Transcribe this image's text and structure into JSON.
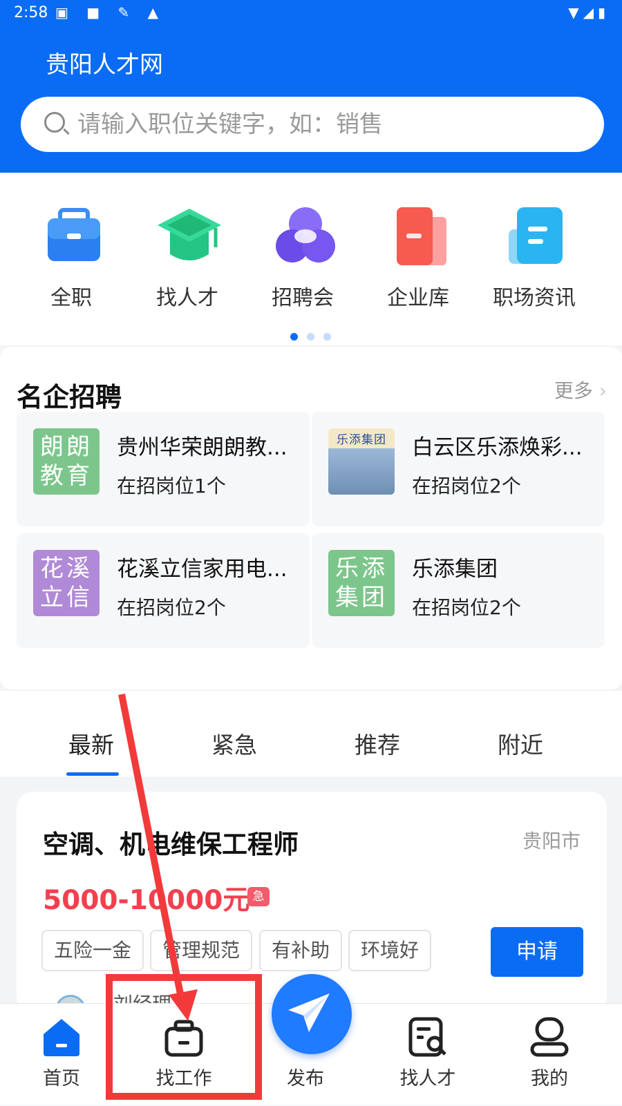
{
  "status_bar": {
    "time": "2:58"
  },
  "header": {
    "title": "贵阳人才网",
    "search_placeholder": "请输入职位关键字，如：销售"
  },
  "categories": [
    {
      "label": "全职",
      "icon": "briefcase-icon",
      "color": "#2b7ff0"
    },
    {
      "label": "找人才",
      "icon": "graduation-cap-icon",
      "color": "#2ccf8f"
    },
    {
      "label": "招聘会",
      "icon": "circles-icon",
      "color": "#7b5cf2"
    },
    {
      "label": "企业库",
      "icon": "building-icon",
      "color": "#f75a4f"
    },
    {
      "label": "职场资讯",
      "icon": "news-icon",
      "color": "#2ab4f1"
    }
  ],
  "famous": {
    "title": "名企招聘",
    "more_label": "更多",
    "companies": [
      {
        "name": "贵州华荣朗朗教...",
        "jobs": "在招岗位1个",
        "logo_text": "朗朗教育",
        "logo_color": "#7cc68c"
      },
      {
        "name": "白云区乐添焕彩...",
        "jobs": "在招岗位2个",
        "logo_text": "乐添集团",
        "logo_color": "#8eb7d8"
      },
      {
        "name": "花溪立信家用电...",
        "jobs": "在招岗位2个",
        "logo_text": "花溪立信",
        "logo_color": "#b08ad6"
      },
      {
        "name": "乐添集团",
        "jobs": "在招岗位2个",
        "logo_text": "乐添集团",
        "logo_color": "#7cc68c"
      }
    ]
  },
  "tabs": [
    "最新",
    "紧急",
    "推荐",
    "附近"
  ],
  "job": {
    "title": "空调、机电维保工程师",
    "city": "贵阳市",
    "salary": "5000-10000元",
    "urgent_label": "急",
    "tags": [
      "五险一金",
      "管理规范",
      "有补助",
      "环境好"
    ],
    "apply_label": "申请",
    "contact": "刘经理"
  },
  "bottom_nav": {
    "items": [
      {
        "label": "首页",
        "icon": "home-icon"
      },
      {
        "label": "找工作",
        "icon": "find-job-icon"
      },
      {
        "label": "发布",
        "icon": "paper-plane-icon"
      },
      {
        "label": "找人才",
        "icon": "talent-search-icon"
      },
      {
        "label": "我的",
        "icon": "user-icon"
      }
    ]
  },
  "colors": {
    "primary": "#0a6cf5",
    "salary": "#f2404f",
    "annotation": "#f23a3a"
  }
}
